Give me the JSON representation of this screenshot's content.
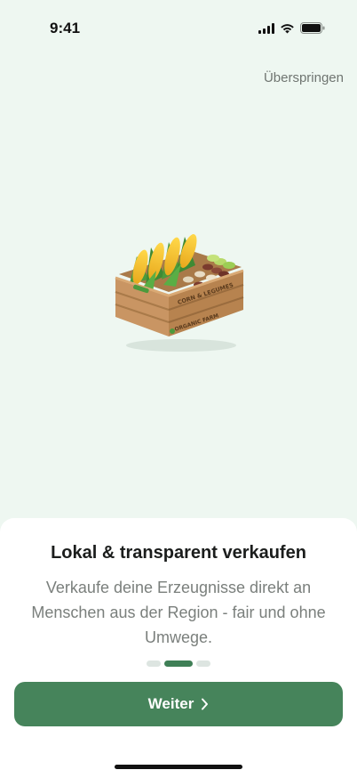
{
  "status_bar": {
    "time": "9:41"
  },
  "header": {
    "skip_label": "Überspringen"
  },
  "illustration": {
    "crate_label": "CORN & LEGUMES",
    "crate_sublabel": "ORGANIC FARM"
  },
  "onboarding": {
    "title": "Lokal & transparent verkaufen",
    "description": "Verkaufe deine Erzeugnisse direkt an Menschen aus der Region - fair und ohne Umwege.",
    "pages_total": 3,
    "current_page": 2,
    "next_label": "Weiter"
  },
  "colors": {
    "background": "#eef7f1",
    "accent": "#46845b"
  }
}
